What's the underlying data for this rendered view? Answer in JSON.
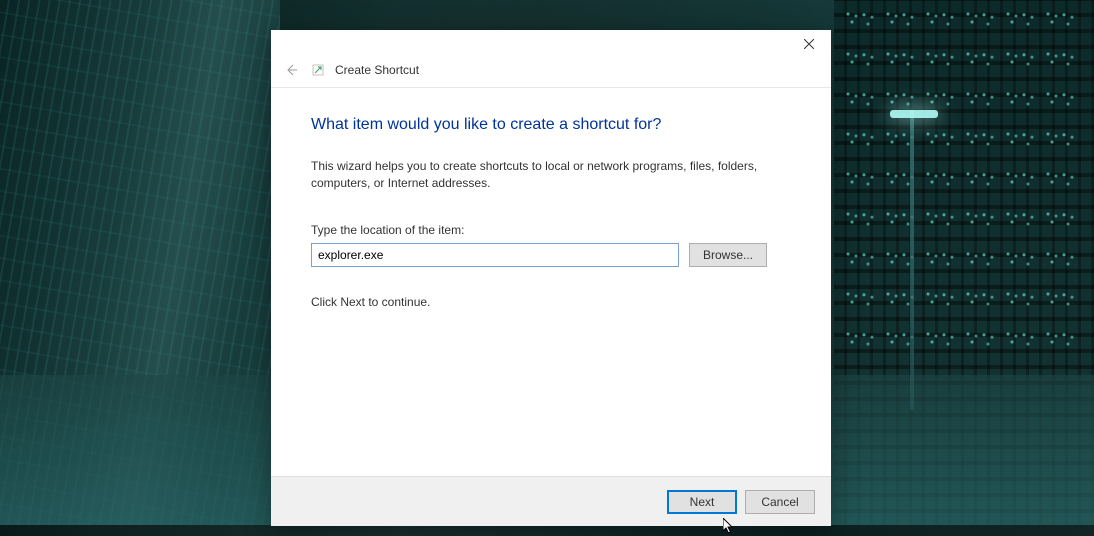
{
  "header": {
    "title": "Create Shortcut"
  },
  "content": {
    "heading": "What item would you like to create a shortcut for?",
    "description": "This wizard helps you to create shortcuts to local or network programs, files, folders, computers, or Internet addresses.",
    "field_label": "Type the location of the item:",
    "input_value": "explorer.exe",
    "browse_label": "Browse...",
    "continue_text": "Click Next to continue."
  },
  "footer": {
    "next_label": "Next",
    "cancel_label": "Cancel"
  }
}
